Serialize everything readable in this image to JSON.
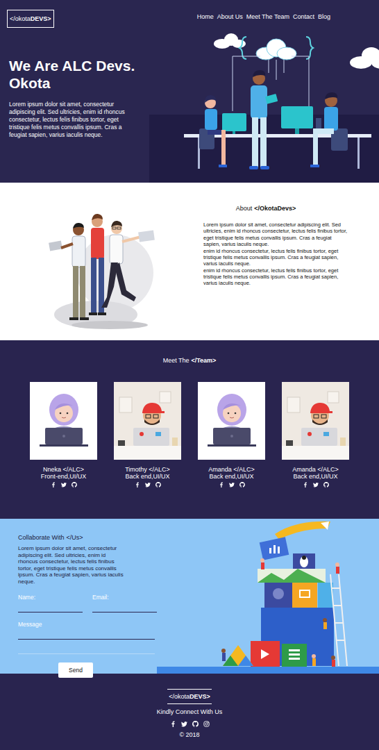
{
  "logo": {
    "light": "</okota",
    "bold": "DEVS>"
  },
  "nav": [
    "Home",
    "About Us",
    "Meet The Team",
    "Contact",
    "Blog"
  ],
  "hero": {
    "title": "We Are ALC Devs. Okota",
    "text": "Lorem ipsum dolor sit amet, consectetur adipiscing elit. Sed ultricies, enim id rhoncus consectetur, lectus felis finibus tortor, eget tristique felis metus convallis ipsum. Cras a feugiat sapien, varius iaculis neque."
  },
  "about": {
    "heading": {
      "prefix": "About",
      "emphasis": "</OkotaDevs>"
    },
    "paragraphs": [
      "Lorem ipsum dolor sit amet, consectetur adipiscing elit. Sed ultricies, enim id rhoncus consectetur, lectus felis finibus tortor, eget tristique felis metus convallis ipsum. Cras a feugiat sapien, varius iaculis neque.",
      "enim id rhoncus consectetur, lectus felis finibus tortor, eget tristique felis metus convallis ipsum. Cras a feugiat sapien, varius iaculis neque.",
      "enim id rhoncus consectetur, lectus felis finibus tortor, eget tristique felis metus convallis ipsum. Cras a feugiat sapien, varius iaculis neque."
    ]
  },
  "team": {
    "heading": {
      "prefix": "Meet The",
      "emphasis": "</Team>"
    },
    "members": [
      {
        "name": "Nneka </ALC>",
        "role": "Front-end,UI/UX",
        "kind": "girl"
      },
      {
        "name": "Timothy </ALC>",
        "role": "Back end,UI/UX",
        "kind": "boy"
      },
      {
        "name": "Amanda </ALC>",
        "role": "Back end,UI/UX",
        "kind": "girl"
      },
      {
        "name": "Amanda </ALC>",
        "role": "Back end,UI/UX",
        "kind": "boy"
      }
    ]
  },
  "collaborate": {
    "heading": {
      "prefix": "Collaborate With",
      "emphasis": "</Us>"
    },
    "text": "Lorem ipsum dolor sit amet, consectetur adipiscing elit. Sed ultricies, enim id rhoncus consectetur, lectus felis finibus tortor, eget tristique felis metus convallis ipsum. Cras a feugiat sapien, varius iaculis neque.",
    "fields": [
      {
        "label": "Name:"
      },
      {
        "label": "Email:"
      }
    ],
    "message": {
      "label": "Message"
    },
    "button": "Send"
  },
  "footer": {
    "tagline": "Kindly Connect With Us",
    "copyright": "© 2018"
  }
}
